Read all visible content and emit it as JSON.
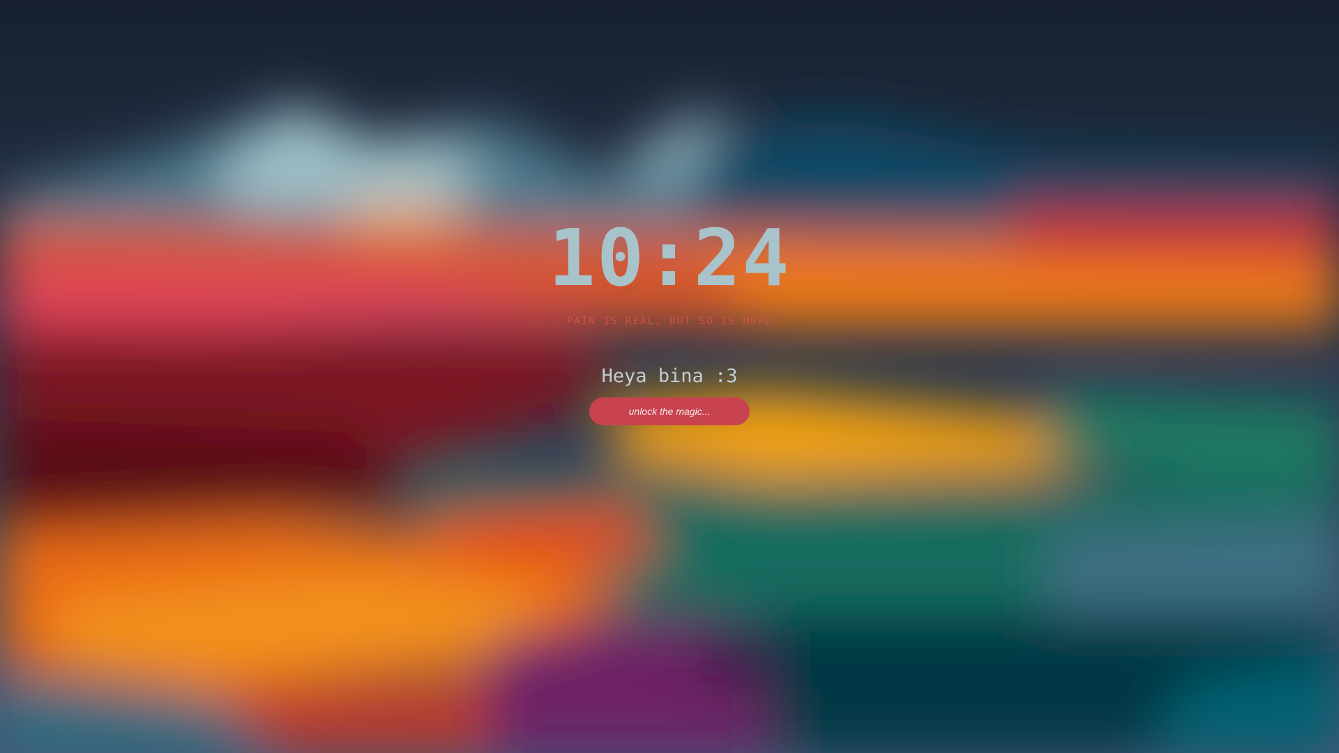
{
  "lockscreen": {
    "time": "10:24",
    "quote": "- PAIN IS REAL, BUT SO IS HOPE -",
    "greeting": "Heya bina :3",
    "password_placeholder": "unlock the magic..."
  },
  "colors": {
    "clock": "#a9c3cb",
    "quote": "#d4544a",
    "greeting": "#c2cdd2",
    "input_background": "#c8434f",
    "input_text": "#f4e6e6"
  }
}
